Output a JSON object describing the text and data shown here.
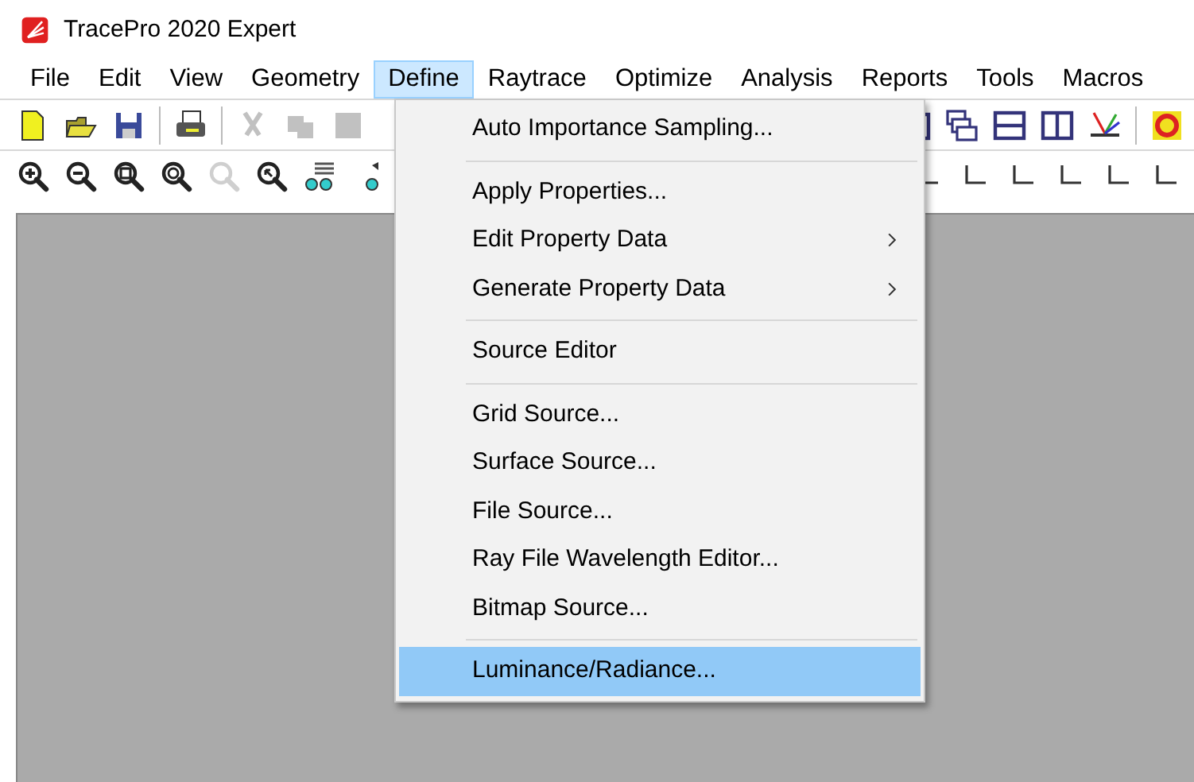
{
  "window": {
    "title": "TracePro 2020 Expert"
  },
  "menu_bar": [
    {
      "label": "File",
      "selected": false
    },
    {
      "label": "Edit",
      "selected": false
    },
    {
      "label": "View",
      "selected": false
    },
    {
      "label": "Geometry",
      "selected": false
    },
    {
      "label": "Define",
      "selected": true
    },
    {
      "label": "Raytrace",
      "selected": false
    },
    {
      "label": "Optimize",
      "selected": false
    },
    {
      "label": "Analysis",
      "selected": false
    },
    {
      "label": "Reports",
      "selected": false
    },
    {
      "label": "Tools",
      "selected": false
    },
    {
      "label": "Macros",
      "selected": false
    }
  ],
  "toolbars": [
    {
      "left": [
        {
          "disabled": false
        },
        {
          "disabled": false
        },
        {
          "disabled": false
        },
        {
          "disabled": false
        },
        {
          "disabled": true
        },
        {
          "disabled": true
        },
        {
          "disabled": true
        }
      ],
      "right": [
        {
          "disabled": false
        },
        {
          "disabled": false
        },
        {
          "disabled": false
        },
        {
          "disabled": false
        },
        {
          "disabled": false
        },
        {
          "disabled": false
        }
      ]
    },
    {
      "left": [
        {
          "disabled": false
        },
        {
          "disabled": false
        },
        {
          "disabled": false
        },
        {
          "disabled": false
        },
        {
          "disabled": true
        },
        {
          "disabled": false
        },
        {
          "disabled": false
        },
        {
          "disabled": false
        }
      ],
      "right": [
        {
          "disabled": false
        },
        {
          "disabled": false
        },
        {
          "disabled": false
        },
        {
          "disabled": false
        },
        {
          "disabled": false
        },
        {
          "disabled": false
        }
      ]
    }
  ],
  "dropdown": {
    "groups": [
      [
        {
          "label": "Auto Importance Sampling...",
          "submenu": false,
          "selected": false
        }
      ],
      [
        {
          "label": "Apply Properties...",
          "submenu": false,
          "selected": false
        },
        {
          "label": "Edit Property Data",
          "submenu": true,
          "selected": false
        },
        {
          "label": "Generate Property Data",
          "submenu": true,
          "selected": false
        }
      ],
      [
        {
          "label": "Source Editor",
          "submenu": false,
          "selected": false
        }
      ],
      [
        {
          "label": "Grid Source...",
          "submenu": false,
          "selected": false
        },
        {
          "label": "Surface Source...",
          "submenu": false,
          "selected": false
        },
        {
          "label": "File Source...",
          "submenu": false,
          "selected": false
        },
        {
          "label": "Ray File Wavelength Editor...",
          "submenu": false,
          "selected": false
        },
        {
          "label": "Bitmap Source...",
          "submenu": false,
          "selected": false
        }
      ],
      [
        {
          "label": "Luminance/Radiance...",
          "submenu": false,
          "selected": true
        }
      ]
    ]
  }
}
